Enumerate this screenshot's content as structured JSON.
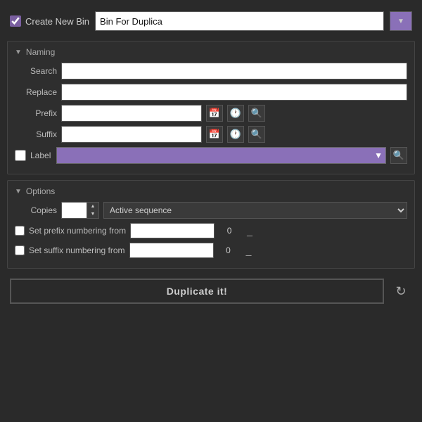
{
  "topBar": {
    "checkboxLabel": "Create New Bin",
    "binName": "Bin For Duplica",
    "colorButtonArrow": "▼"
  },
  "naming": {
    "sectionTitle": "Naming",
    "toggleArrow": "▼",
    "searchLabel": "Search",
    "replaceLabel": "Replace",
    "prefixLabel": "Prefix",
    "suffixLabel": "Suffix",
    "labelLabel": "Label",
    "searchValue": "",
    "replaceValue": "",
    "prefixValue": "",
    "suffixValue": "",
    "calendarIcon": "📅",
    "clockIcon": "🕐",
    "searchIcon": "🔍",
    "dropdownArrow": "▼"
  },
  "options": {
    "sectionTitle": "Options",
    "toggleArrow": "▼",
    "copiesLabel": "Copies",
    "copiesValue": "",
    "sequenceOptions": [
      "Active sequence"
    ],
    "sequenceSelected": "Active sequence",
    "sequenceArrow": "▼",
    "setPrefixLabel": "Set prefix numbering from",
    "prefixFromValue": "",
    "prefixFromNumber": "0",
    "setSuffixLabel": "Set suffix numbering from",
    "suffixFromValue": "",
    "suffixFromNumber": "0"
  },
  "bottomBar": {
    "duplicateLabel": "Duplicate it!",
    "refreshIcon": "↻"
  }
}
